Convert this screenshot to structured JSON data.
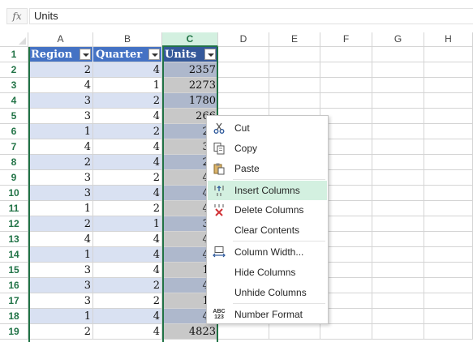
{
  "formula_bar": {
    "fx_label": "fx",
    "value": "Units"
  },
  "columns": [
    "A",
    "B",
    "C",
    "D",
    "E",
    "F",
    "G",
    "H"
  ],
  "selected_column": "C",
  "rows": [
    1,
    2,
    3,
    4,
    5,
    6,
    7,
    8,
    9,
    10,
    11,
    12,
    13,
    14,
    15,
    16,
    17,
    18,
    19
  ],
  "table": {
    "headers": [
      "Region",
      "Quarter",
      "Units"
    ],
    "data": [
      [
        "2",
        "4",
        "2357"
      ],
      [
        "4",
        "1",
        "2273"
      ],
      [
        "3",
        "2",
        "1780"
      ],
      [
        "3",
        "4",
        "266"
      ],
      [
        "1",
        "2",
        "22"
      ],
      [
        "4",
        "4",
        "35"
      ],
      [
        "2",
        "4",
        "24"
      ],
      [
        "3",
        "2",
        "48"
      ],
      [
        "3",
        "4",
        "41"
      ],
      [
        "1",
        "2",
        "41"
      ],
      [
        "2",
        "1",
        "38"
      ],
      [
        "4",
        "4",
        "47"
      ],
      [
        "1",
        "4",
        "44"
      ],
      [
        "3",
        "4",
        "18"
      ],
      [
        "3",
        "2",
        "45"
      ],
      [
        "3",
        "2",
        "15"
      ],
      [
        "1",
        "4",
        "48"
      ],
      [
        "2",
        "4",
        "4823"
      ]
    ]
  },
  "context_menu": {
    "items": [
      {
        "label": "Cut",
        "icon": "scissors-icon"
      },
      {
        "label": "Copy",
        "icon": "copy-icon"
      },
      {
        "label": "Paste",
        "icon": "paste-icon"
      },
      {
        "label": "Insert Columns",
        "icon": "insert-columns-icon",
        "highlighted": true
      },
      {
        "label": "Delete Columns",
        "icon": "delete-columns-icon"
      },
      {
        "label": "Clear Contents",
        "icon": ""
      },
      {
        "label": "Column Width...",
        "icon": "column-width-icon"
      },
      {
        "label": "Hide Columns",
        "icon": ""
      },
      {
        "label": "Unhide Columns",
        "icon": ""
      },
      {
        "label": "Number Format",
        "icon": "number-format-icon"
      }
    ]
  },
  "colors": {
    "accent": "#217346",
    "table_header": "#4472c4",
    "band": "#d9e1f2",
    "menu_highlight": "#d3f0e0"
  }
}
